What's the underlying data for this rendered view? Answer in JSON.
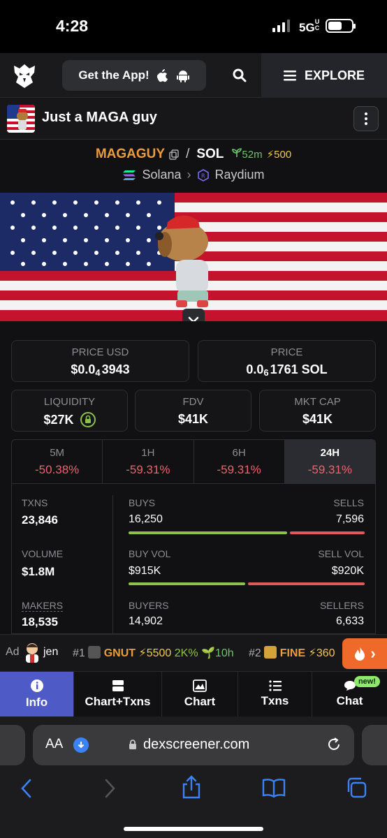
{
  "status_bar": {
    "time": "4:28",
    "network": "5G",
    "network_suffix": "UC"
  },
  "nav": {
    "get_app_label": "Get the App!",
    "explore_label": "EXPLORE"
  },
  "token": {
    "name": "Just a MAGA guy"
  },
  "pair": {
    "base": "MAGAGUY",
    "quote": "SOL",
    "age": "52m",
    "boosts": "500",
    "chain": "Solana",
    "dex": "Raydium"
  },
  "price_usd": {
    "label": "PRICE USD",
    "prefix": "$0.0",
    "zeros": "4",
    "digits": "3943"
  },
  "price_native": {
    "label": "PRICE",
    "prefix": "0.0",
    "zeros": "6",
    "digits": "1761 SOL"
  },
  "metrics": [
    {
      "label": "LIQUIDITY",
      "value": "$27K"
    },
    {
      "label": "FDV",
      "value": "$41K"
    },
    {
      "label": "MKT CAP",
      "value": "$41K"
    }
  ],
  "timeframes": [
    {
      "label": "5M",
      "change": "-50.38%"
    },
    {
      "label": "1H",
      "change": "-59.31%"
    },
    {
      "label": "6H",
      "change": "-59.31%"
    },
    {
      "label": "24H",
      "change": "-59.31%"
    }
  ],
  "stats": {
    "txns": {
      "label": "TXNS",
      "value": "23,846"
    },
    "buys": {
      "label": "BUYS",
      "value": "16,250"
    },
    "sells": {
      "label": "SELLS",
      "value": "7,596"
    },
    "buys_ratio": 0.68,
    "volume": {
      "label": "VOLUME",
      "value": "$1.8M"
    },
    "buy_vol": {
      "label": "BUY VOL",
      "value": "$915K"
    },
    "sell_vol": {
      "label": "SELL VOL",
      "value": "$920K"
    },
    "buy_vol_ratio": 0.5,
    "makers": {
      "label": "MAKERS",
      "value": "18,535"
    },
    "buyers": {
      "label": "BUYERS",
      "value": "14,902"
    },
    "sellers": {
      "label": "SELLERS",
      "value": "6,633"
    }
  },
  "ticker": {
    "ad_label": "Ad",
    "ad_name": "jen",
    "items": [
      {
        "rank": "#1",
        "symbol": "GNUT",
        "boosts": "5500",
        "change": "2K%",
        "age": "10h"
      },
      {
        "rank": "#2",
        "symbol": "FINE",
        "boosts": "360"
      }
    ]
  },
  "bottom_tabs": [
    {
      "label": "Info"
    },
    {
      "label": "Chart+Txns"
    },
    {
      "label": "Chart"
    },
    {
      "label": "Txns"
    },
    {
      "label": "Chat",
      "badge": "new!"
    }
  ],
  "browser": {
    "aa": "AA",
    "host": "dexscreener.com"
  },
  "colors": {
    "accent_orange": "#ea9b3b",
    "positive": "#8bc34a",
    "negative": "#e05a5a",
    "active_tab": "#4e5bc7"
  }
}
